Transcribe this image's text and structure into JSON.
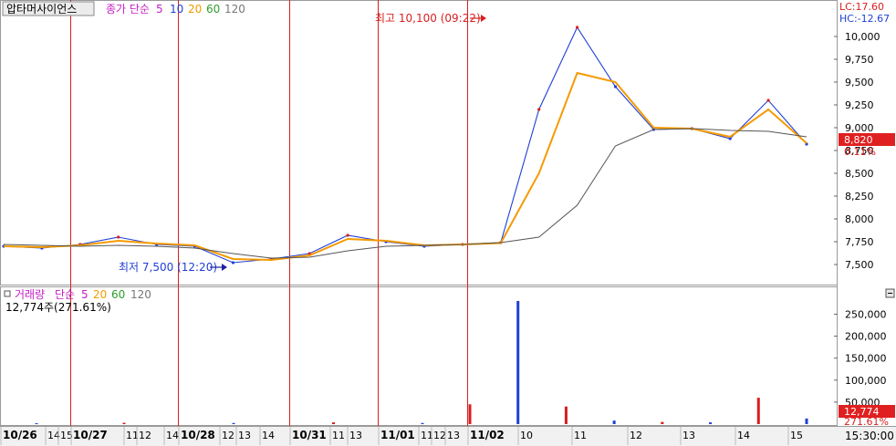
{
  "price_panel": {
    "stock_name": "압타머사이언스",
    "legend_prefix": "종가 단순",
    "ma_periods": [
      "5",
      "10",
      "20",
      "60",
      "120"
    ],
    "lc_label": "LC:17.60",
    "hc_label": "HC:-12.67",
    "high_marker": "최고 10,100 (09:22)",
    "low_marker": "최저 7,500 (12:20)",
    "last_price": "8,820",
    "change_pct": "0.11%"
  },
  "volume_panel": {
    "title": "거래량",
    "legend_prefix": "단순",
    "ma_periods": [
      "5",
      "20",
      "60",
      "120"
    ],
    "current_volume": "12,774주(271.61%)",
    "last_volume": "12,774",
    "ratio_label": "271.61%"
  },
  "colors": {
    "ma5": "#f59a00",
    "ma10": "#7e9a00",
    "ma20": "#2e9e2e",
    "ma60": "#222222",
    "ma120": "#555555",
    "candle_up": "#d81f1f",
    "candle_down": "#1f3fd8",
    "vline": "#d81f1f",
    "price_badge": "#e02020"
  },
  "chart_data": [
    {
      "type": "line",
      "title": "압타머사이언스",
      "x": [
        "10/26 09:00",
        "10/26 14:00",
        "10/27 09:00",
        "10/27 11:00",
        "10/27 14:00",
        "10/28 09:00",
        "10/28 12:00",
        "10/28 14:00",
        "10/31 09:00",
        "10/31 11:00",
        "10/31 13:00",
        "11/01 09:00",
        "11/01 11:00",
        "11/01 13:00",
        "11/02 09:00",
        "11/02 09:22",
        "11/02 10:00",
        "11/02 11:00",
        "11/02 12:00",
        "11/02 13:00",
        "11/02 14:00",
        "11/02 15:00"
      ],
      "series": [
        {
          "name": "종가",
          "values": [
            7700,
            7680,
            7720,
            7800,
            7720,
            7700,
            7520,
            7560,
            7620,
            7820,
            7750,
            7700,
            7720,
            7740,
            9200,
            10100,
            9450,
            8980,
            8990,
            8880,
            9300,
            8820
          ]
        },
        {
          "name": "5",
          "values": [
            7700,
            7690,
            7710,
            7760,
            7730,
            7710,
            7560,
            7550,
            7600,
            7780,
            7760,
            7710,
            7720,
            7735,
            8500,
            9600,
            9500,
            9000,
            8990,
            8900,
            9200,
            8830
          ]
        },
        {
          "name": "120",
          "values": [
            7720,
            7710,
            7700,
            7710,
            7700,
            7680,
            7620,
            7570,
            7580,
            7650,
            7700,
            7710,
            7720,
            7740,
            7800,
            8150,
            8800,
            8980,
            8990,
            8970,
            8960,
            8900
          ]
        }
      ],
      "y_ticks": [
        "10,000",
        "9,750",
        "9,500",
        "9,250",
        "9,000",
        "8,750",
        "8,500",
        "8,250",
        "8,000",
        "7,750",
        "7,500"
      ],
      "ylim": [
        7400,
        10100
      ],
      "grid": false,
      "legend": "top-left"
    },
    {
      "type": "bar",
      "title": "거래량",
      "x": [
        "10/26",
        "10/27",
        "10/28",
        "10/31",
        "11/01",
        "11/02 09:00",
        "11/02 09:22",
        "11/02 10:00",
        "11/02 11:00",
        "11/02 12:00",
        "11/02 13:00",
        "11/02 14:00",
        "11/02 15:00"
      ],
      "values": [
        2000,
        3000,
        2500,
        4000,
        2500,
        45000,
        280000,
        40000,
        8000,
        5000,
        4000,
        60000,
        12774
      ],
      "y_ticks": [
        "250,000",
        "200,000",
        "150,000",
        "100,000",
        "50,000"
      ],
      "ylim": [
        0,
        280000
      ]
    }
  ],
  "x_axis": {
    "labels": [
      "10/26",
      "14",
      "15",
      "10/27",
      "11",
      "12",
      "14",
      "10/28",
      "12",
      "13",
      "14",
      "10/31",
      "11",
      "13",
      "11/01",
      "11",
      "12",
      "13",
      "11/02",
      "10",
      "11",
      "12",
      "13",
      "14",
      "15"
    ],
    "time_label": "15:30:00"
  }
}
